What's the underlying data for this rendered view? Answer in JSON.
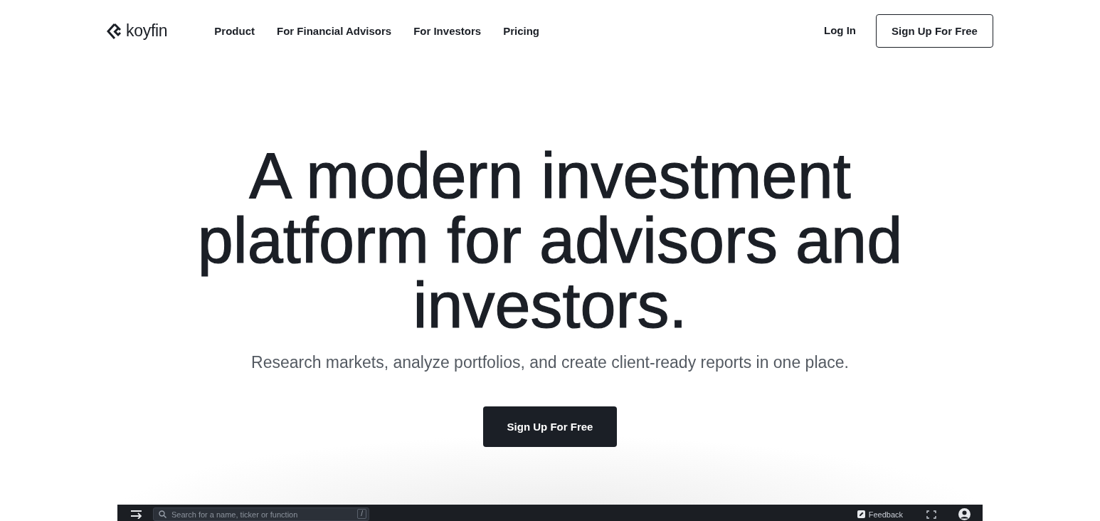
{
  "nav": {
    "logo": "koyfin",
    "links": [
      "Product",
      "For Financial Advisors",
      "For Investors",
      "Pricing"
    ],
    "login": "Log In",
    "signup": "Sign Up For Free"
  },
  "hero": {
    "title": "A modern investment platform for advisors and investors.",
    "subtitle": "Research markets, analyze portfolios, and create client-ready reports in one place.",
    "cta": "Sign Up For Free"
  },
  "app_preview": {
    "search": {
      "placeholder": "Search for a name, ticker or function",
      "shortcut": "/"
    },
    "feedback": "Feedback"
  }
}
